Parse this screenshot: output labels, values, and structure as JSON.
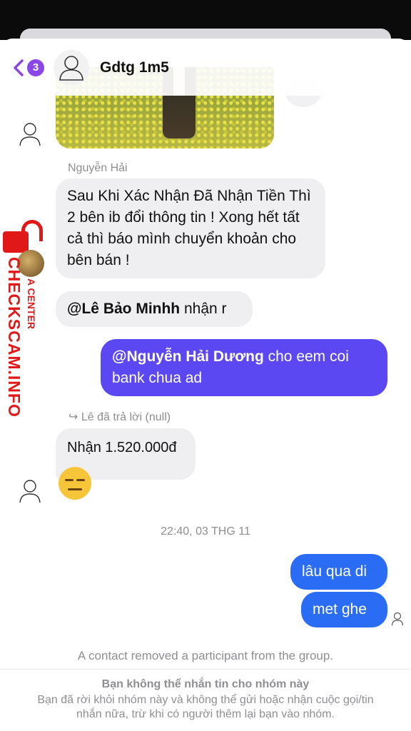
{
  "header": {
    "back_badge": "3",
    "group_name": "Gdtg 1m5"
  },
  "messages": {
    "sender": "Nguyễn Hải",
    "msg1": "Sau Khi Xác Nhận Đã Nhận Tiền Thì 2 bên ib đổi thông tin ! Xong hết tất cả thì báo mình chuyển khoản cho bên bán !",
    "msg2_mention": "@Lê Bảo Minhh",
    "msg2_text": " nhận r",
    "out1_mention": "@Nguyễn Hải Dương",
    "out1_text": " cho eem coi bank chua ad",
    "reply_info": "Lê đã trả lời (null)",
    "msg3": "Nhận 1.520.000đ",
    "timestamp": "22:40, 03 THG 11",
    "out2": "lâu qua di",
    "out3": "met ghe"
  },
  "system_note": "A contact removed a participant from the group.",
  "footer": {
    "title": "Bạn không thể nhắn tin cho nhóm này",
    "description": "Bạn đã rời khỏi nhóm này và không thể gửi hoặc nhận cuộc gọi/tin nhắn nữa, trừ khi có người thêm lại bạn vào nhóm."
  },
  "watermark": {
    "main": "CHECKSCAM.INFO",
    "sub": "A CENTER"
  },
  "colors": {
    "accent": "#8a46e6",
    "outgoing_bubble": "#5b48f2",
    "outgoing_bubble_2": "#2b6cf5",
    "incoming_bubble": "#efeff1",
    "watermark_red": "#e01818"
  }
}
